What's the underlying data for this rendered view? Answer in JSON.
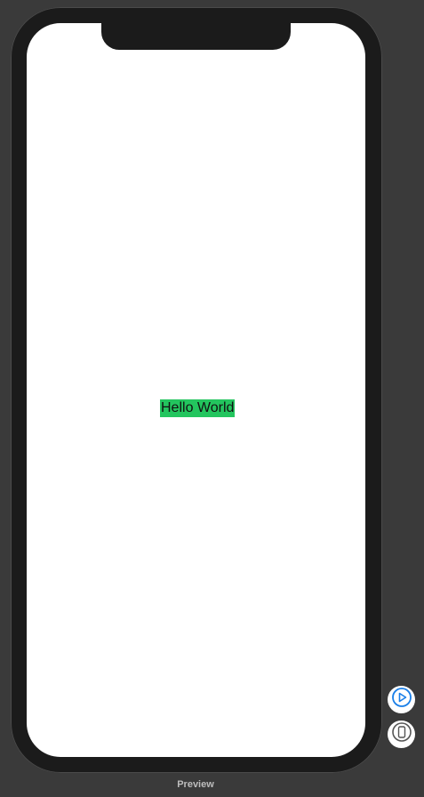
{
  "screen": {
    "label_text": "Hello World",
    "label_background": "#23c55e"
  },
  "controls": {
    "live_preview_icon": "play-circle-icon",
    "device_icon": "device-icon"
  },
  "footer": {
    "preview_label": "Preview"
  },
  "colors": {
    "canvas": "#3a3a3a",
    "device_frame": "#1b1b1b",
    "screen": "#ffffff",
    "accent": "#1a7fe8"
  }
}
